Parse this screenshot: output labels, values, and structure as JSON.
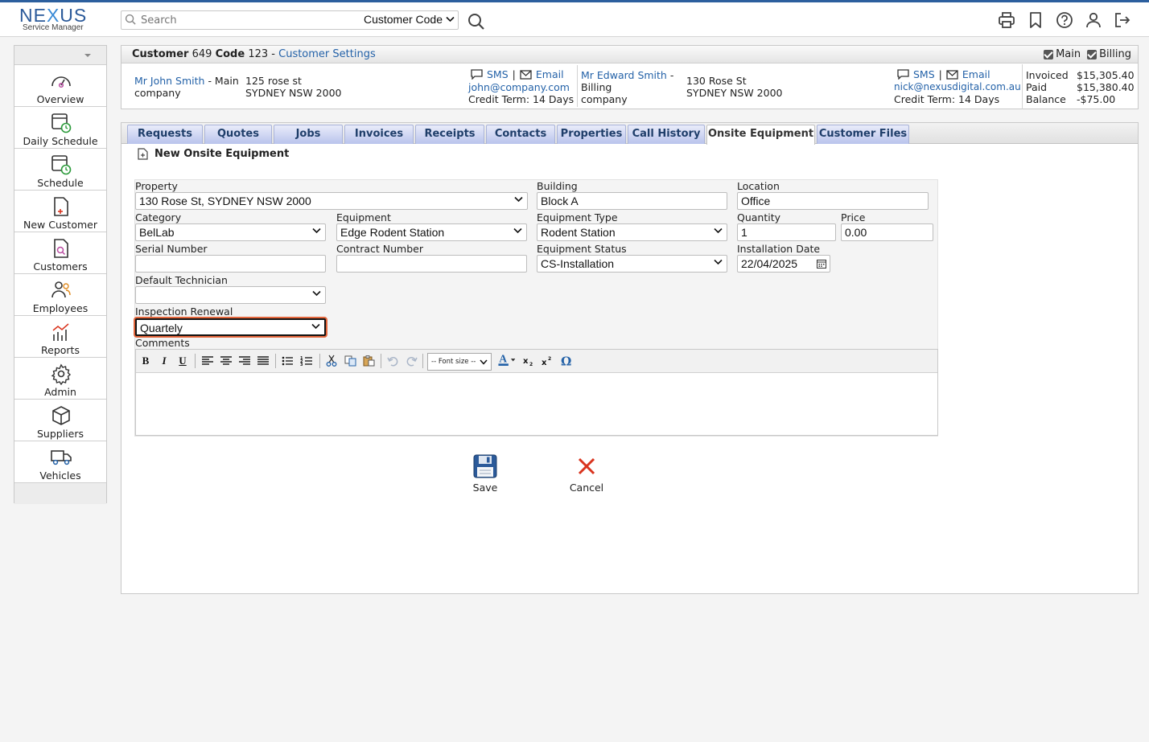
{
  "brand": {
    "name_prefix": "NE",
    "name_x": "X",
    "name_suffix": "US",
    "subtitle": "Service Manager"
  },
  "search": {
    "placeholder": "Search",
    "value": "",
    "scope": "Customer Code"
  },
  "sidebar": {
    "items": [
      {
        "label": "Overview",
        "icon": "gauge-icon"
      },
      {
        "label": "Daily Schedule",
        "icon": "calendar-clock-icon"
      },
      {
        "label": "Schedule",
        "icon": "calendar-clock-icon"
      },
      {
        "label": "New Customer",
        "icon": "new-document-icon"
      },
      {
        "label": "Customers",
        "icon": "document-search-icon"
      },
      {
        "label": "Employees",
        "icon": "users-icon"
      },
      {
        "label": "Reports",
        "icon": "chart-icon"
      },
      {
        "label": "Admin",
        "icon": "gear-icon"
      },
      {
        "label": "Suppliers",
        "icon": "box-icon"
      },
      {
        "label": "Vehicles",
        "icon": "truck-icon"
      }
    ]
  },
  "customer": {
    "label": "Customer",
    "number": "649",
    "code_label": "Code",
    "code": "123",
    "separator": "-",
    "settings_link": "Customer Settings",
    "main_checkbox": "Main",
    "billing_checkbox": "Billing",
    "main_contact": {
      "name": "Mr John Smith",
      "role": "- Main",
      "company": "company",
      "address1": "125 rose st",
      "address2": "SYDNEY NSW 2000",
      "sms": "SMS",
      "pipe": "|",
      "email_label": "Email",
      "email": "john@company.com",
      "credit": "Credit Term: 14 Days"
    },
    "billing_contact": {
      "name": "Mr Edward Smith",
      "role_dash": "-",
      "role": "Billing",
      "company": "company",
      "address1": "130 Rose St",
      "address2": "SYDNEY NSW 2000",
      "sms": "SMS",
      "pipe": "|",
      "email_label": "Email",
      "email": "nick@nexusdigital.com.au",
      "credit": "Credit Term: 14 Days"
    },
    "totals": {
      "invoiced_label": "Invoiced",
      "invoiced": "$15,305.40",
      "paid_label": "Paid",
      "paid": "$15,380.40",
      "balance_label": "Balance",
      "balance": "-$75.00"
    }
  },
  "tabs": [
    "Requests",
    "Quotes",
    "Jobs",
    "Invoices",
    "Receipts",
    "Contacts",
    "Properties",
    "Call History",
    "Onsite Equipment",
    "Customer Files"
  ],
  "active_tab": "Onsite Equipment",
  "form": {
    "title": "New Onsite Equipment",
    "property": {
      "label": "Property",
      "value": "130 Rose St, SYDNEY NSW 2000"
    },
    "building": {
      "label": "Building",
      "value": "Block A"
    },
    "location": {
      "label": "Location",
      "value": "Office"
    },
    "category": {
      "label": "Category",
      "value": "BelLab"
    },
    "equipment": {
      "label": "Equipment",
      "value": "Edge Rodent Station"
    },
    "equipment_type": {
      "label": "Equipment Type",
      "value": "Rodent Station"
    },
    "quantity": {
      "label": "Quantity",
      "value": "1"
    },
    "price": {
      "label": "Price",
      "value": "0.00"
    },
    "serial_number": {
      "label": "Serial Number",
      "value": ""
    },
    "contract_number": {
      "label": "Contract Number",
      "value": ""
    },
    "equipment_status": {
      "label": "Equipment Status",
      "value": "CS-Installation"
    },
    "installation_date": {
      "label": "Installation Date",
      "value": "22/04/2025"
    },
    "default_technician": {
      "label": "Default Technician",
      "value": ""
    },
    "inspection_renewal": {
      "label": "Inspection Renewal",
      "value": "Quartely"
    },
    "comments": {
      "label": "Comments",
      "font_size_placeholder": "-- Font size --"
    },
    "save_label": "Save",
    "cancel_label": "Cancel"
  },
  "colors": {
    "accent": "#2c5f9e",
    "link": "#2462a8",
    "focus_ring": "#e4663c",
    "cancel": "#d9341e"
  }
}
